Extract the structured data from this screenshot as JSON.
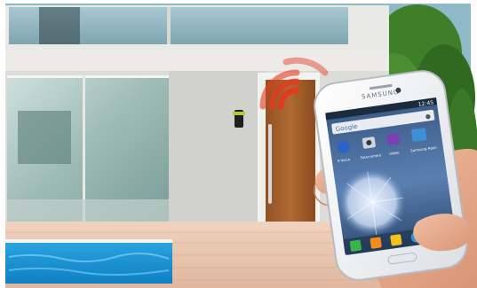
{
  "phone": {
    "brand": "SAMSUNG",
    "status_time": "12:45",
    "search_provider": "Google",
    "apps": [
      {
        "label": "S Voice",
        "icon": "microphone-icon"
      },
      {
        "label": "Fotocamera",
        "icon": "camera-icon"
      },
      {
        "label": "Video",
        "icon": "video-icon"
      },
      {
        "label": "Samsung Apps",
        "icon": "store-icon"
      }
    ],
    "dock": [
      "phone-icon",
      "contacts-icon",
      "messages-icon",
      "internet-icon",
      "apps-icon"
    ]
  },
  "colors": {
    "sky": "#7fb3c9",
    "wall": "#dcdcd8",
    "door": "#a35f2a",
    "pool": "#1e9ad6",
    "deck": "#e7c3ab",
    "signal": "#e23a1e",
    "hedge": "#3f7f2a"
  }
}
